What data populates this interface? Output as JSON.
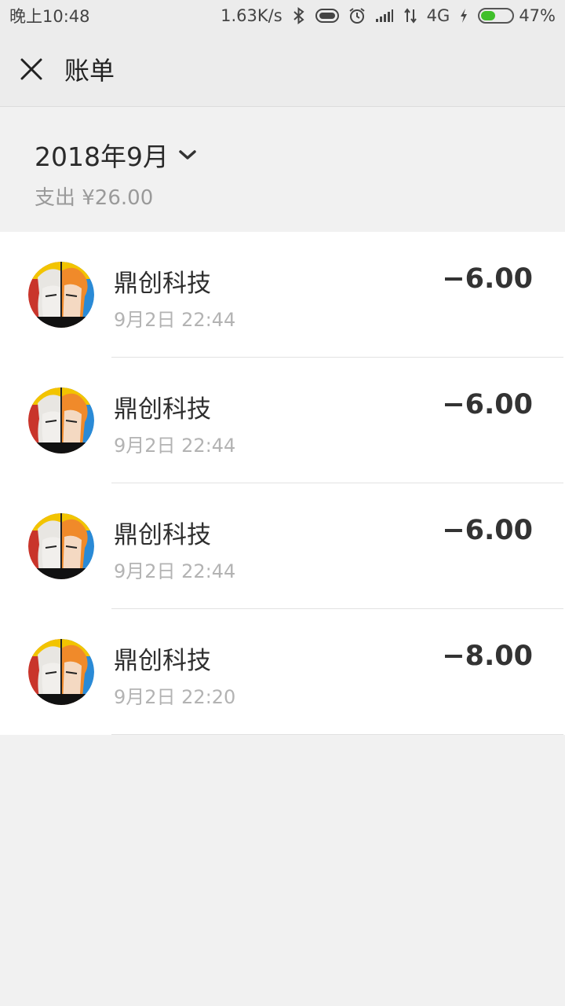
{
  "status_bar": {
    "time": "晚上10:48",
    "net_speed": "1.63K/s",
    "network": "4G",
    "battery": "47%",
    "battery_level": 0.47
  },
  "nav": {
    "title": "账单"
  },
  "month": {
    "label": "2018年9月",
    "summary": "支出 ¥26.00"
  },
  "bills": [
    {
      "merchant": "鼎创科技",
      "time": "9月2日 22:44",
      "amount": "−6.00"
    },
    {
      "merchant": "鼎创科技",
      "time": "9月2日 22:44",
      "amount": "−6.00"
    },
    {
      "merchant": "鼎创科技",
      "time": "9月2日 22:44",
      "amount": "−6.00"
    },
    {
      "merchant": "鼎创科技",
      "time": "9月2日 22:20",
      "amount": "−8.00"
    }
  ],
  "colors": {
    "background": "#f1f1f1",
    "list_background": "#ffffff",
    "secondary_text": "#b3b3b3",
    "battery_green": "#3fbf2a"
  }
}
